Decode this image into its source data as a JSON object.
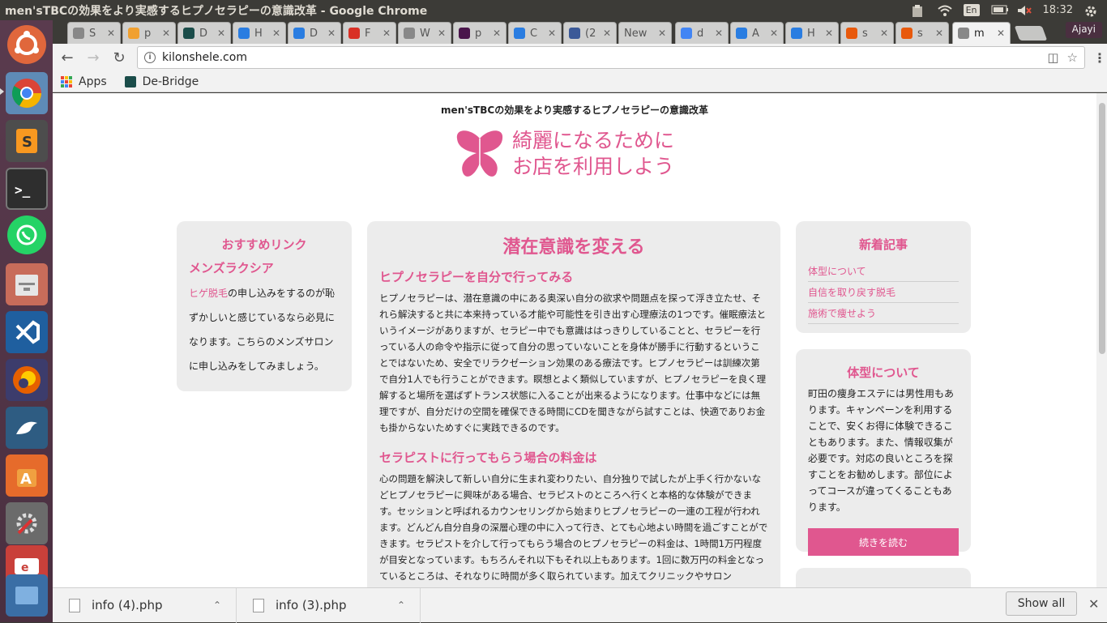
{
  "window": {
    "title": "men'sTBCの効果をより実感するヒプノセラピーの意識改革 - Google Chrome"
  },
  "tray": {
    "lang": "En",
    "time": "18:32",
    "user": "Ajayi"
  },
  "tabs": [
    {
      "label": "S",
      "icon": "doc-icon",
      "color": "#888888"
    },
    {
      "label": "p",
      "icon": "pma-icon",
      "color": "#f0a030"
    },
    {
      "label": "D",
      "icon": "debridge-icon",
      "color": "#1b4d4a"
    },
    {
      "label": "H",
      "icon": "loop-icon",
      "color": "#2a7de1"
    },
    {
      "label": "D",
      "icon": "loop-icon",
      "color": "#2a7de1"
    },
    {
      "label": "F",
      "icon": "gmail-icon",
      "color": "#d93025"
    },
    {
      "label": "W",
      "icon": "doc-icon",
      "color": "#888888"
    },
    {
      "label": "p",
      "icon": "slack-icon",
      "color": "#4a154b"
    },
    {
      "label": "C",
      "icon": "loop-icon",
      "color": "#2a7de1"
    },
    {
      "label": "(2",
      "icon": "facebook-icon",
      "color": "#3b5998"
    },
    {
      "label": "New",
      "icon": "",
      "color": ""
    },
    {
      "label": "d",
      "icon": "google-icon",
      "color": "#4285f4"
    },
    {
      "label": "A",
      "icon": "loop-icon",
      "color": "#2a7de1"
    },
    {
      "label": "H",
      "icon": "loop-icon",
      "color": "#2a7de1"
    },
    {
      "label": "s",
      "icon": "ask-icon",
      "color": "#e8590c"
    },
    {
      "label": "s",
      "icon": "ask-icon",
      "color": "#e8590c"
    },
    {
      "label": "m",
      "icon": "doc-icon",
      "color": "#888888"
    }
  ],
  "toolbar": {
    "url": "kilonshele.com"
  },
  "bookmarks": {
    "apps": "Apps",
    "debridge": "De-Bridge"
  },
  "site": {
    "header_title": "men'sTBCの効果をより実感するヒプノセラピーの意識改革",
    "logo_line1": "綺麗になるために",
    "logo_line2": "お店を利用しよう",
    "logo_color": "#e0578f"
  },
  "left_sidebar": {
    "heading": "おすすめリンク",
    "subheading": "メンズラクシア",
    "link": "ヒゲ脱毛",
    "text": "の申し込みをするのが恥ずかしいと感じているなら必見になります。こちらのメンズサロンに申し込みをしてみましょう。"
  },
  "main": {
    "heading": "潜在意識を変える",
    "section1_title": "ヒプノセラピーを自分で行ってみる",
    "section1_text": "ヒプノセラピーは、潜在意識の中にある奥深い自分の欲求や問題点を探って浮き立たせ、それら解決すると共に本来持っている才能や可能性を引き出す心理療法の1つです。催眠療法というイメージがありますが、セラピー中でも意識ははっきりしていることと、セラピーを行っている人の命令や指示に従って自分の思っていないことを身体が勝手に行動するということではないため、安全でリラクゼーション効果のある療法です。ヒプノセラピーは訓練次第で自分1人でも行うことができます。瞑想とよく類似していますが、ヒプノセラピーを良く理解すると場所を選ばずトランス状態に入ることが出来るようになります。仕事中などには無理ですが、自分だけの空間を確保できる時間にCDを聞きながら試すことは、快適でありお金も掛からないためすぐに実践できるのです。",
    "section2_title": "セラピストに行ってもらう場合の料金は",
    "section2_text": "心の問題を解決して新しい自分に生まれ変わりたい、自分独りで試したが上手く行かないなどヒプノセラピーに興味がある場合、セラピストのところへ行くと本格的な体験ができます。セッションと呼ばれるカウンセリングから始まりヒプノセラピーの一連の工程が行われます。どんどん自分自身の深層心理の中に入って行き、とても心地よい時間を過ごすことができます。セラピストを介して行ってもらう場合のヒプノセラピーの料金は、1時間1万円程度が目安となっています。もちろんそれ以下もそれ以上もあります。1回に数万円の料金となっているところは、それなりに時間が多く取られています。加えてクリニックやサロン"
  },
  "right_sidebar": {
    "news_heading": "新着記事",
    "news_items": [
      "体型について",
      "自信を取り戻す脱毛",
      "施術で痩せよう"
    ],
    "type_heading": "体型について",
    "type_text": "町田の痩身エステには男性用もあります。キャンペーンを利用することで、安くお得に体験できることもあります。また、情報収集が必要です。対応の良いところを探すことをお勧めします。部位によってコースが違ってくることもあります。",
    "read_more": "続きを読む"
  },
  "downloads": {
    "items": [
      "info (4).php",
      "info (3).php"
    ],
    "show_all": "Show all"
  }
}
